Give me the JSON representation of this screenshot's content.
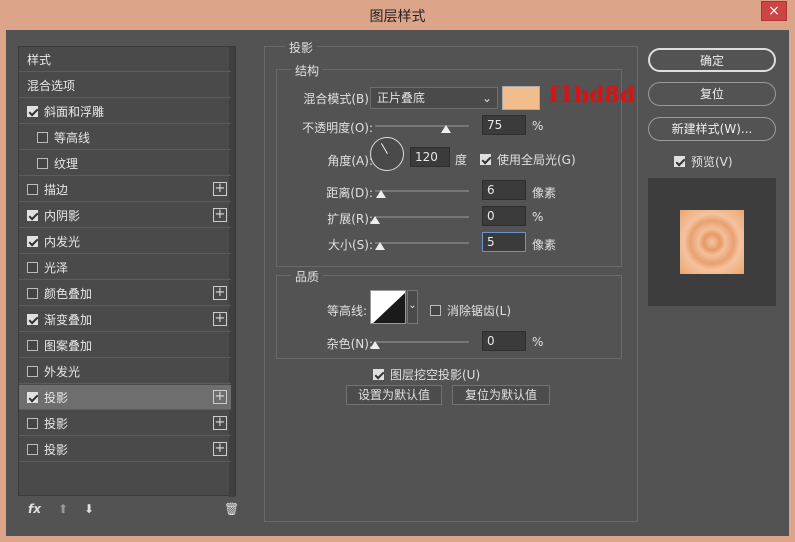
{
  "window": {
    "title": "图层样式",
    "close": "×"
  },
  "sidebar": {
    "items": [
      {
        "label": "样式",
        "checkbox": null,
        "plus": false,
        "indent": 0
      },
      {
        "label": "混合选项",
        "checkbox": null,
        "plus": false,
        "indent": 0
      },
      {
        "label": "斜面和浮雕",
        "checkbox": true,
        "plus": false,
        "indent": 0
      },
      {
        "label": "等高线",
        "checkbox": false,
        "plus": false,
        "indent": 1
      },
      {
        "label": "纹理",
        "checkbox": false,
        "plus": false,
        "indent": 1
      },
      {
        "label": "描边",
        "checkbox": false,
        "plus": true,
        "indent": 0
      },
      {
        "label": "内阴影",
        "checkbox": true,
        "plus": true,
        "indent": 0
      },
      {
        "label": "内发光",
        "checkbox": true,
        "plus": false,
        "indent": 0
      },
      {
        "label": "光泽",
        "checkbox": false,
        "plus": false,
        "indent": 0
      },
      {
        "label": "颜色叠加",
        "checkbox": false,
        "plus": true,
        "indent": 0
      },
      {
        "label": "渐变叠加",
        "checkbox": true,
        "plus": true,
        "indent": 0
      },
      {
        "label": "图案叠加",
        "checkbox": false,
        "plus": false,
        "indent": 0
      },
      {
        "label": "外发光",
        "checkbox": false,
        "plus": false,
        "indent": 0
      },
      {
        "label": "投影",
        "checkbox": true,
        "plus": true,
        "indent": 0,
        "selected": true
      },
      {
        "label": "投影",
        "checkbox": false,
        "plus": true,
        "indent": 0
      },
      {
        "label": "投影",
        "checkbox": false,
        "plus": true,
        "indent": 0
      }
    ],
    "fx": "fx"
  },
  "panel": {
    "title": "投影",
    "structure": {
      "title": "结构",
      "blend_label": "混合模式(B):",
      "blend_value": "正片叠底",
      "color": "#f1bd8d",
      "color_note": "f1bd8d",
      "opacity_label": "不透明度(O):",
      "opacity_value": "75",
      "opacity_level": 0.75,
      "percent": "%",
      "angle_label": "角度(A):",
      "angle_value": "120",
      "angle_unit": "度",
      "global_light_label": "使用全局光(G)",
      "distance_label": "距离(D):",
      "distance_value": "6",
      "pixel_unit": "像素",
      "spread_label": "扩展(R):",
      "spread_value": "0",
      "size_label": "大小(S):",
      "size_value": "5"
    },
    "quality": {
      "title": "品质",
      "contour_label": "等高线:",
      "antialias_label": "消除锯齿(L)",
      "noise_label": "杂色(N):",
      "noise_value": "0"
    },
    "knockout_label": "图层挖空投影(U)",
    "set_default": "设置为默认值",
    "reset_default": "复位为默认值"
  },
  "buttons": {
    "ok": "确定",
    "reset": "复位",
    "new_style": "新建样式(W)...",
    "preview": "预览(V)"
  }
}
